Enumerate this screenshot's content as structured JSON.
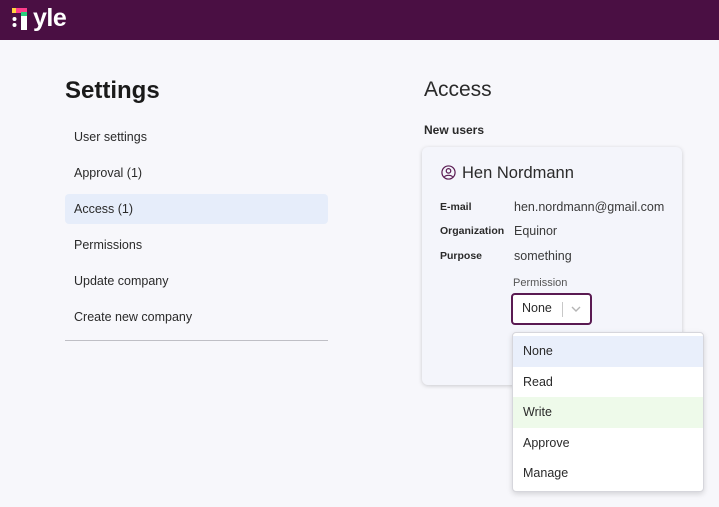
{
  "app": {
    "logo_text": "yle"
  },
  "settings": {
    "title": "Settings",
    "nav": [
      {
        "label": "User settings"
      },
      {
        "label": "Approval (1)"
      },
      {
        "label": "Access (1)"
      },
      {
        "label": "Permissions"
      },
      {
        "label": "Update company"
      },
      {
        "label": "Create new company"
      }
    ]
  },
  "access": {
    "title": "Access",
    "section_label": "New users",
    "user": {
      "name": "Hen Nordmann",
      "fields": [
        {
          "label": "E-mail",
          "value": "hen.nordmann@gmail.com"
        },
        {
          "label": "Organization",
          "value": "Equinor"
        },
        {
          "label": "Purpose",
          "value": "something"
        }
      ]
    },
    "permission": {
      "label": "Permission",
      "selected": "None",
      "options": [
        "None",
        "Read",
        "Write",
        "Approve",
        "Manage"
      ]
    }
  },
  "colors": {
    "topbar": "#4a0f43",
    "active_nav": "#e6edfa",
    "select_border": "#5a1a52"
  },
  "icons": {
    "logo": "tyle-logo-mark",
    "user": "user-circle-icon",
    "dropdown": "chevron-down-icon"
  }
}
